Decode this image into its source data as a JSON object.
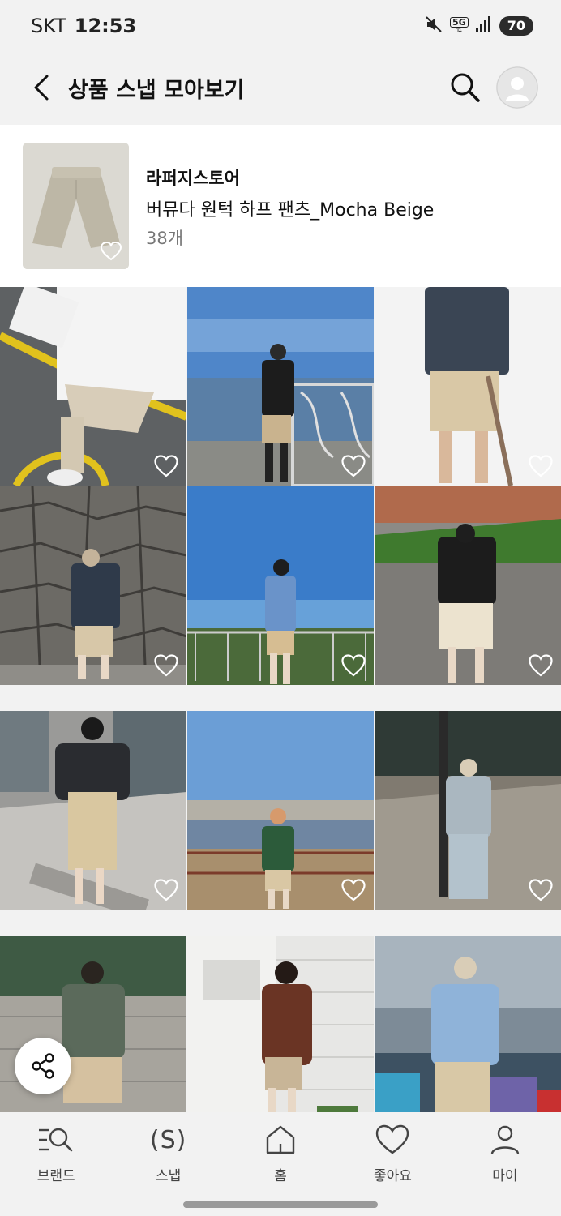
{
  "status_bar": {
    "carrier": "SKT",
    "time": "12:53",
    "network": "5G",
    "battery": "70"
  },
  "header": {
    "title": "상품 스냅 모아보기"
  },
  "product": {
    "brand": "라퍼지스토어",
    "name": "버뮤다 원턱 하프 팬츠_Mocha Beige",
    "count": "38개"
  },
  "icons": {
    "back": "chevron-left-icon",
    "search": "search-icon",
    "avatar": "user-avatar-icon",
    "like": "heart-icon",
    "share": "share-icon"
  },
  "colors": {
    "accent_heart": "#ffffff",
    "nav_text": "#444444"
  },
  "bottom_nav": {
    "items": [
      {
        "label": "브랜드"
      },
      {
        "label": "스냅",
        "glyph": "(S)"
      },
      {
        "label": "홈"
      },
      {
        "label": "좋아요"
      },
      {
        "label": "마이"
      }
    ]
  }
}
